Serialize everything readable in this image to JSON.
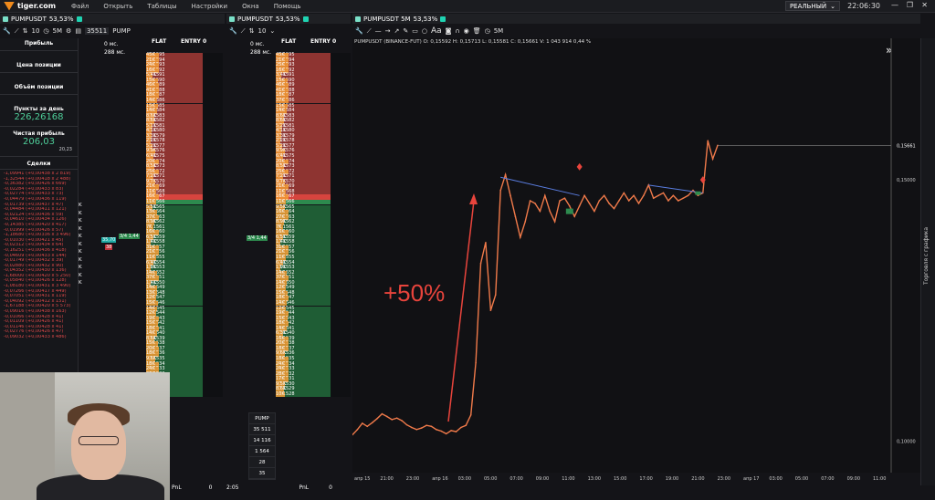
{
  "app": {
    "brand": "tiger.com",
    "menu": [
      "Файл",
      "Открыть",
      "Таблицы",
      "Настройки",
      "Окна",
      "Помощь"
    ],
    "account": "РЕАЛЬНЫЙ",
    "time": "22:06:30"
  },
  "pane1": {
    "symbol": "PUMPUSDT",
    "change": "53,53%",
    "interval": "5M",
    "size": "35511",
    "symbol_short": "PUMP",
    "ten": "10"
  },
  "pane2": {
    "symbol": "PUMPUSDT",
    "change": "53,53%",
    "ten": "10"
  },
  "pane3": {
    "symbol": "PUMPUSDT 5M",
    "change": "53,53%",
    "interval": "5M",
    "ohlc": "PUMPUSDT (BINANCE-FUT) O: 0,15592  H: 0,15713  L: 0,15581  C: 0,15661  V: 1 043 914  0,44 %"
  },
  "left": {
    "profit_label": "Прибыль",
    "pos_price_label": "Цена позиции",
    "pos_vol_label": "Объём позиции",
    "points_label": "Пункты за день",
    "points_value": "226,26168",
    "net_label": "Чистая прибыль",
    "net_value": "206,03",
    "net_small": "20,23",
    "trades_label": "Сделки",
    "trades": [
      "-1,09941 (+0,00438 x 2 819)",
      "-1,32544 (+0,00418 x 2 488)",
      "-0,36382 (+0,00426 x 669)",
      "-0,02284 (+0,00433 x 83)",
      "-0,02774 (+0,00433 x 73)",
      "-0,04479 (+0,00436 x 119)",
      "-0,01739 (+0,00437 x 47)",
      "-0,04484 (+0,00411 x 121)",
      "-0,02124 (+0,00436 x 59)",
      "-0,04610 (+0,00434 x 126)",
      "-0,14385 (+0,00420 x 417)",
      "-0,01999 (+0,00426 x 57)",
      "-1,18680 (+0,00336 x 3 496)",
      "-0,01030 (+0,00421 x 45)",
      "-0,02312 (+0,00434 x 64)",
      "-0,16251 (+0,00436 x 418)",
      "-0,04609 (+0,00433 x 144)",
      "-0,01749 (+0,00432 x 39)",
      "-0,02880 (+0,00432 x 90)",
      "-0,04352 (+0,00430 x 136)",
      "-1,68000 (+0,00420 x 5 250)",
      "-0,05840 (+0,00426 x 128)",
      "-1,08180 (+0,00431 x 3 490)",
      "-0,07266 (+0,00417 x 449)",
      "-0,07051 (+0,00431 x 119)",
      "-0,04092 (+0,00412 x 151)",
      "-1,67188 (+0,00420 x 5 573)",
      "-0,09016 (+0,00438 x 163)",
      "-0,01066 (+0,00428 x 41)",
      "-0,01109 (+0,00426 x 41)",
      "-0,01146 (+0,00428 x 41)",
      "-0,02776 (+0,00426 x 47)",
      "-0,09032 (+0,00433 x 486)"
    ],
    "k_marks": [
      "K",
      "K",
      "K",
      "K",
      "K",
      "K",
      "K",
      "K",
      "K",
      "K",
      "K"
    ]
  },
  "orderbook": {
    "header_a": "FLAT",
    "header_b": "ENTRY",
    "header_c": "0",
    "ms_a": "0 мс.",
    "ms_b": "288 мс.",
    "pnl": "PnL",
    "pnl_val": "0",
    "t205": "2:05",
    "prices": [
      "0,1595",
      "0,1594",
      "0,1593",
      "0,1592",
      "0,1591",
      "0,1590",
      "0,1589",
      "0,1588",
      "0,1587",
      "0,1586",
      "0,1585",
      "0,1584",
      "0,1583",
      "0,1582",
      "0,1581",
      "0,1580",
      "0,1579",
      "0,1578",
      "0,1577",
      "0,1576",
      "0,1575",
      "0,1574",
      "0,1573",
      "0,1572",
      "0,1571",
      "0,1570",
      "0,1569",
      "0,1568",
      "0,1567",
      "0,1566",
      "0,1565",
      "0,1564",
      "0,1563",
      "0,1562",
      "0,1561",
      "0,1560",
      "0,1559",
      "0,1558",
      "0,1557",
      "0,1556",
      "0,1555",
      "0,1554",
      "0,1553",
      "0,1552",
      "0,1551",
      "0,1550",
      "0,1549",
      "0,1548",
      "0,1547",
      "0,1546",
      "0,1545",
      "0,1544",
      "0,1543",
      "0,1542",
      "0,1541",
      "0,1540",
      "0,1539",
      "0,1538",
      "0,1537",
      "0,1536",
      "0,1535",
      "0,1534",
      "0,1533",
      "0,1532",
      "0,1531",
      "0,1530",
      "0,1529",
      "0,1528"
    ],
    "vols1": [
      "45K",
      "21K",
      "24K",
      "16K",
      "5,4K",
      "15K",
      "46K",
      "41K",
      "18K",
      "14K",
      "15K",
      "14K",
      "8,6K",
      "8,6K",
      "5,1K",
      "4,1K",
      "3,3K",
      "2,2K",
      "5,2K",
      "9,9K",
      "6,4K",
      "20K",
      "8,5K",
      "25K",
      "7,2K",
      "9,7K",
      "21K",
      "11K",
      "16K",
      "11K",
      "5,5K",
      "13K",
      "37K",
      "8,9K",
      "7K",
      "16K",
      "6,5K",
      "1,4K",
      "31K",
      "21K",
      "11K",
      "6,4K",
      "1,9K",
      "14K",
      "37K",
      "1,4K",
      "14K",
      "13K",
      "12K",
      "15K",
      "14K",
      "12K",
      "19K",
      "15K",
      "18K",
      "14K",
      "8,6K",
      "15K",
      "20K",
      "18K",
      "9,6K",
      "18K",
      "24K",
      "24K",
      "28K",
      "17K",
      "9,5K",
      "8,6K"
    ],
    "vols2": [
      "45K",
      "21K",
      "25K",
      "16K",
      "3,4K",
      "15K",
      "46K",
      "41K",
      "18K",
      "37K",
      "15K",
      "14K",
      "8,6K",
      "8,6K",
      "5,2K",
      "4,1K",
      "3,3K",
      "2,2K",
      "5,2K",
      "9,9K",
      "6,4K",
      "20K",
      "8,5K",
      "25K",
      "7,2K",
      "9,7K",
      "21K",
      "11K",
      "16K",
      "11K",
      "9,5K",
      "16K",
      "27K",
      "8,9K",
      "7K",
      "16K",
      "6,5K",
      "1,4K",
      "31K",
      "21K",
      "11K",
      "6,4K",
      "1,9K",
      "14K",
      "37K",
      "14K",
      "12K",
      "15K",
      "18K",
      "14K",
      "12K",
      "19K",
      "15K",
      "18K",
      "14K",
      "6,3K",
      "16K",
      "20K",
      "18K",
      "9,6K",
      "18K",
      "24K",
      "24K",
      "28K",
      "17K",
      "9,5K",
      "8,6K",
      "10K"
    ],
    "best_ask": "16K",
    "best_bid": "11K",
    "order_a": "35,70",
    "order_b": "3/4 1,44",
    "order_c": "38",
    "pane2_a": "3/4 1,44"
  },
  "pumpbox": {
    "title": "PUMP",
    "items": [
      "35 511",
      "14 116",
      "1 564",
      "28",
      "35"
    ]
  },
  "chart_data": {
    "type": "line",
    "title": "",
    "xlabel": "",
    "ylabel": "",
    "x_ticks": [
      "апр 15",
      "21:00",
      "23:00",
      "апр 16",
      "03:00",
      "05:00",
      "07:00",
      "09:00",
      "11:00",
      "13:00",
      "15:00",
      "17:00",
      "19:00",
      "21:00",
      "23:00",
      "апр 17",
      "03:00",
      "05:00",
      "07:00",
      "09:00",
      "11:00"
    ],
    "y_ticks": [
      "0,15000",
      "0,10000"
    ],
    "last_price": "0,15661",
    "annotation": "+50%",
    "ylim": [
      0.095,
      0.175
    ],
    "series": [
      {
        "values": [
          0.1012,
          0.1022,
          0.1034,
          0.1028,
          0.1035,
          0.1043,
          0.1052,
          0.1047,
          0.1041,
          0.1044,
          0.1039,
          0.1031,
          0.1026,
          0.1022,
          0.1025,
          0.103,
          0.1028,
          0.1022,
          0.1019,
          0.1014,
          0.102,
          0.1018,
          0.1026,
          0.103,
          0.105,
          0.115,
          0.134,
          0.138,
          0.125,
          0.128,
          0.148,
          0.151,
          0.147,
          0.143,
          0.139,
          0.142,
          0.146,
          0.1455,
          0.144,
          0.147,
          0.144,
          0.142,
          0.146,
          0.1465,
          0.145,
          0.143,
          0.145,
          0.147,
          0.1455,
          0.144,
          0.146,
          0.147,
          0.1455,
          0.1445,
          0.146,
          0.1475,
          0.146,
          0.147,
          0.1455,
          0.147,
          0.149,
          0.1465,
          0.147,
          0.1475,
          0.146,
          0.147,
          0.146,
          0.1465,
          0.147,
          0.148,
          0.147,
          0.1475,
          0.1575,
          0.154,
          0.1566
        ]
      }
    ]
  },
  "side": {
    "label": "Торговля с графика"
  },
  "colors": {
    "ask": "#8e3431",
    "bid": "#1f5d35",
    "accent": "#f39a33",
    "price_line": "#f07a4a",
    "arrow": "#e8443c"
  }
}
